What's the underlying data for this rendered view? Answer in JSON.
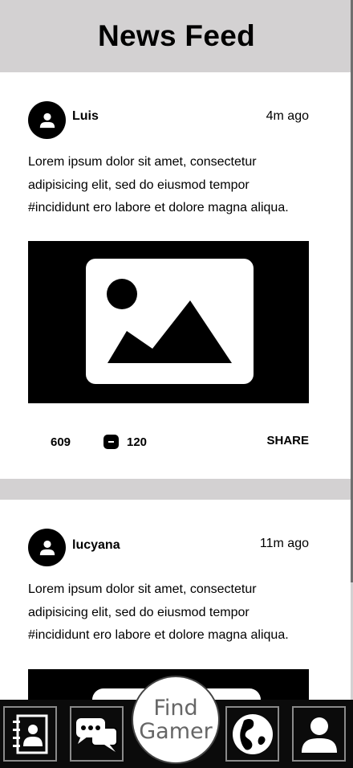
{
  "header": {
    "title": "News Feed"
  },
  "posts": [
    {
      "author": "Luis",
      "time": "4m ago",
      "body_lines": [
        "Lorem ipsum dolor sit amet, consectetur",
        "adipisicing elit, sed do eiusmod tempor",
        "#incididunt ero labore et dolore magna aliqua."
      ],
      "likes": "609",
      "comments": "120",
      "share_label": "SHARE",
      "avatar_icon": "user-icon",
      "image_icon": "image-placeholder-icon"
    },
    {
      "author": "lucyana",
      "time": "11m ago",
      "body_lines": [
        "Lorem ipsum dolor sit amet, consectetur",
        "adipisicing elit, sed do eiusmod tempor",
        "#incididunt ero labore et dolore magna aliqua."
      ],
      "avatar_icon": "user-icon",
      "image_icon": "image-placeholder-icon"
    }
  ],
  "bottom_nav": {
    "find_line1": "Find",
    "find_line2": "Gamer",
    "items": [
      {
        "icon": "contacts-icon"
      },
      {
        "icon": "chat-icon"
      },
      {
        "icon": "globe-icon"
      },
      {
        "icon": "profile-icon"
      }
    ]
  },
  "colors": {
    "background": "#d3d1d2",
    "card": "#ffffff",
    "nav": "#0b0b0b",
    "accent": "#000000"
  }
}
